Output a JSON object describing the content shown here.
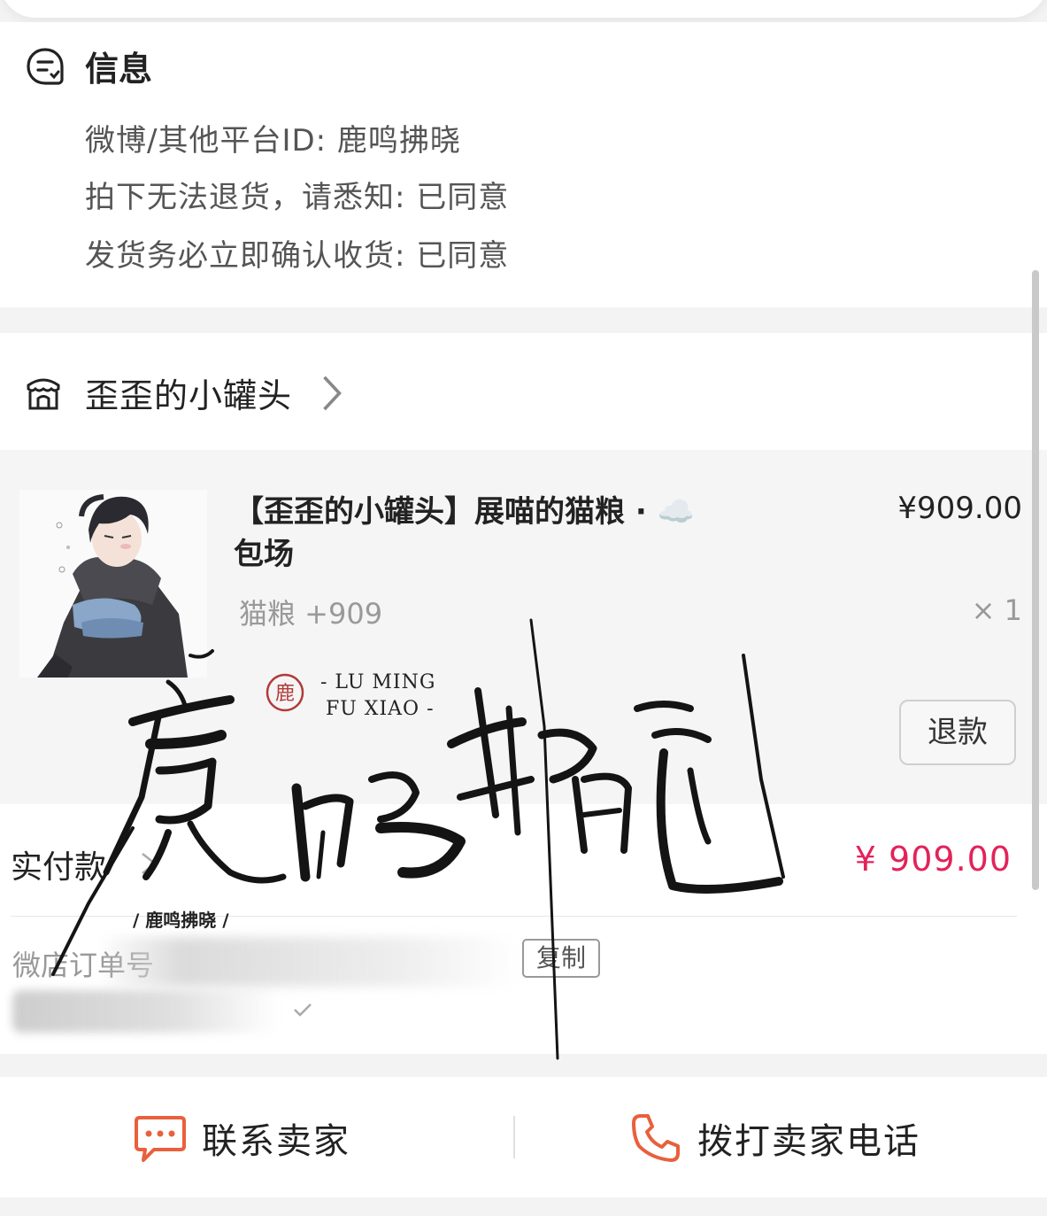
{
  "info": {
    "title": "信息",
    "lines": [
      "微博/其他平台ID: 鹿鸣拂晓",
      "拍下无法退货，请悉知: 已同意",
      "发货务必立即确认收货: 已同意"
    ]
  },
  "shop": {
    "name": "歪歪的小罐头"
  },
  "product": {
    "title_line1": "【歪歪的小罐头】展喵的猫粮 · ☁️",
    "title_line2": "包场",
    "price": "¥909.00",
    "spec": "猫粮 +909",
    "qty": "× 1",
    "refund_label": "退款"
  },
  "payment": {
    "label": "实付款",
    "amount": "¥ 909.00",
    "order_label": "微店订单号",
    "copy_label": "复制"
  },
  "bottom": {
    "contact_label": "联系卖家",
    "call_label": "拨打卖家电话"
  },
  "watermark": {
    "seal": "鹿",
    "latin_line1": "- LU MING",
    "latin_line2": "FU XIAO -",
    "small_text": "/ 鹿鸣拂晓 /",
    "calligraphy": "鹿鸣拂晓"
  },
  "colors": {
    "accent_red": "#e2235a",
    "icon_orange": "#e8603c"
  }
}
